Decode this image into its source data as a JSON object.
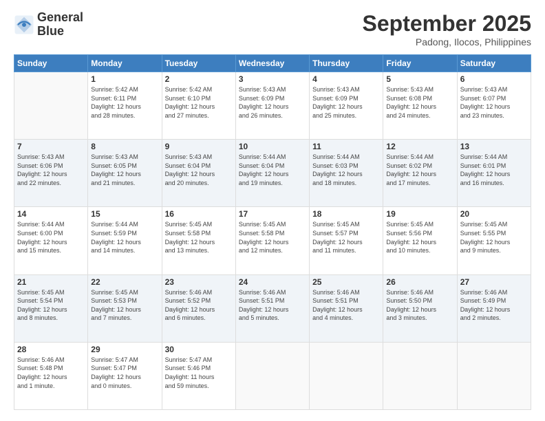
{
  "logo": {
    "line1": "General",
    "line2": "Blue"
  },
  "title": {
    "month_year": "September 2025",
    "location": "Padong, Ilocos, Philippines"
  },
  "days_of_week": [
    "Sunday",
    "Monday",
    "Tuesday",
    "Wednesday",
    "Thursday",
    "Friday",
    "Saturday"
  ],
  "weeks": [
    [
      {
        "day": "",
        "info": ""
      },
      {
        "day": "1",
        "info": "Sunrise: 5:42 AM\nSunset: 6:11 PM\nDaylight: 12 hours\nand 28 minutes."
      },
      {
        "day": "2",
        "info": "Sunrise: 5:42 AM\nSunset: 6:10 PM\nDaylight: 12 hours\nand 27 minutes."
      },
      {
        "day": "3",
        "info": "Sunrise: 5:43 AM\nSunset: 6:09 PM\nDaylight: 12 hours\nand 26 minutes."
      },
      {
        "day": "4",
        "info": "Sunrise: 5:43 AM\nSunset: 6:09 PM\nDaylight: 12 hours\nand 25 minutes."
      },
      {
        "day": "5",
        "info": "Sunrise: 5:43 AM\nSunset: 6:08 PM\nDaylight: 12 hours\nand 24 minutes."
      },
      {
        "day": "6",
        "info": "Sunrise: 5:43 AM\nSunset: 6:07 PM\nDaylight: 12 hours\nand 23 minutes."
      }
    ],
    [
      {
        "day": "7",
        "info": "Sunrise: 5:43 AM\nSunset: 6:06 PM\nDaylight: 12 hours\nand 22 minutes."
      },
      {
        "day": "8",
        "info": "Sunrise: 5:43 AM\nSunset: 6:05 PM\nDaylight: 12 hours\nand 21 minutes."
      },
      {
        "day": "9",
        "info": "Sunrise: 5:43 AM\nSunset: 6:04 PM\nDaylight: 12 hours\nand 20 minutes."
      },
      {
        "day": "10",
        "info": "Sunrise: 5:44 AM\nSunset: 6:04 PM\nDaylight: 12 hours\nand 19 minutes."
      },
      {
        "day": "11",
        "info": "Sunrise: 5:44 AM\nSunset: 6:03 PM\nDaylight: 12 hours\nand 18 minutes."
      },
      {
        "day": "12",
        "info": "Sunrise: 5:44 AM\nSunset: 6:02 PM\nDaylight: 12 hours\nand 17 minutes."
      },
      {
        "day": "13",
        "info": "Sunrise: 5:44 AM\nSunset: 6:01 PM\nDaylight: 12 hours\nand 16 minutes."
      }
    ],
    [
      {
        "day": "14",
        "info": "Sunrise: 5:44 AM\nSunset: 6:00 PM\nDaylight: 12 hours\nand 15 minutes."
      },
      {
        "day": "15",
        "info": "Sunrise: 5:44 AM\nSunset: 5:59 PM\nDaylight: 12 hours\nand 14 minutes."
      },
      {
        "day": "16",
        "info": "Sunrise: 5:45 AM\nSunset: 5:58 PM\nDaylight: 12 hours\nand 13 minutes."
      },
      {
        "day": "17",
        "info": "Sunrise: 5:45 AM\nSunset: 5:58 PM\nDaylight: 12 hours\nand 12 minutes."
      },
      {
        "day": "18",
        "info": "Sunrise: 5:45 AM\nSunset: 5:57 PM\nDaylight: 12 hours\nand 11 minutes."
      },
      {
        "day": "19",
        "info": "Sunrise: 5:45 AM\nSunset: 5:56 PM\nDaylight: 12 hours\nand 10 minutes."
      },
      {
        "day": "20",
        "info": "Sunrise: 5:45 AM\nSunset: 5:55 PM\nDaylight: 12 hours\nand 9 minutes."
      }
    ],
    [
      {
        "day": "21",
        "info": "Sunrise: 5:45 AM\nSunset: 5:54 PM\nDaylight: 12 hours\nand 8 minutes."
      },
      {
        "day": "22",
        "info": "Sunrise: 5:45 AM\nSunset: 5:53 PM\nDaylight: 12 hours\nand 7 minutes."
      },
      {
        "day": "23",
        "info": "Sunrise: 5:46 AM\nSunset: 5:52 PM\nDaylight: 12 hours\nand 6 minutes."
      },
      {
        "day": "24",
        "info": "Sunrise: 5:46 AM\nSunset: 5:51 PM\nDaylight: 12 hours\nand 5 minutes."
      },
      {
        "day": "25",
        "info": "Sunrise: 5:46 AM\nSunset: 5:51 PM\nDaylight: 12 hours\nand 4 minutes."
      },
      {
        "day": "26",
        "info": "Sunrise: 5:46 AM\nSunset: 5:50 PM\nDaylight: 12 hours\nand 3 minutes."
      },
      {
        "day": "27",
        "info": "Sunrise: 5:46 AM\nSunset: 5:49 PM\nDaylight: 12 hours\nand 2 minutes."
      }
    ],
    [
      {
        "day": "28",
        "info": "Sunrise: 5:46 AM\nSunset: 5:48 PM\nDaylight: 12 hours\nand 1 minute."
      },
      {
        "day": "29",
        "info": "Sunrise: 5:47 AM\nSunset: 5:47 PM\nDaylight: 12 hours\nand 0 minutes."
      },
      {
        "day": "30",
        "info": "Sunrise: 5:47 AM\nSunset: 5:46 PM\nDaylight: 11 hours\nand 59 minutes."
      },
      {
        "day": "",
        "info": ""
      },
      {
        "day": "",
        "info": ""
      },
      {
        "day": "",
        "info": ""
      },
      {
        "day": "",
        "info": ""
      }
    ]
  ]
}
